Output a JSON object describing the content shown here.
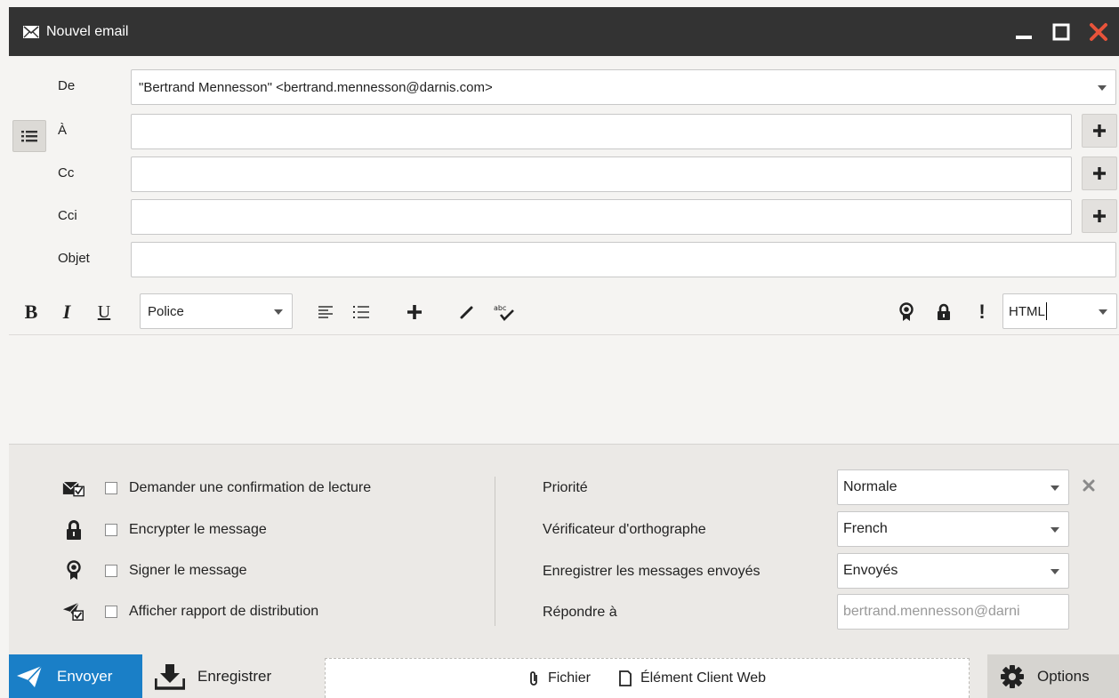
{
  "window": {
    "title": "Nouvel email",
    "icons": {
      "title": "envelope-icon",
      "minimize": "minimize-icon",
      "maximize": "maximize-icon",
      "close": "close-icon"
    },
    "colors": {
      "titlebar_bg": "#333333",
      "close_accent": "#e8533a",
      "send_bg": "#1a7fc7"
    }
  },
  "header": {
    "from": {
      "label": "De",
      "value": "\"Bertrand Mennesson\" <bertrand.mennesson@darnis.com>"
    },
    "to": {
      "label": "À",
      "value": ""
    },
    "cc": {
      "label": "Cc",
      "value": ""
    },
    "bcc": {
      "label": "Cci",
      "value": ""
    },
    "subject": {
      "label": "Objet",
      "value": ""
    }
  },
  "toolbar": {
    "bold": "B",
    "italic": "I",
    "underline": "U",
    "font": "Police",
    "format": "HTML",
    "important": "!"
  },
  "options": {
    "read_receipt": "Demander une confirmation de lecture",
    "encrypt": "Encrypter le message",
    "sign": "Signer le message",
    "delivery_report": "Afficher rapport de distribution",
    "priority": {
      "label": "Priorité",
      "value": "Normale"
    },
    "spellcheck": {
      "label": "Vérificateur d'orthographe",
      "value": "French"
    },
    "save_sent": {
      "label": "Enregistrer les messages envoyés",
      "value": "Envoyés"
    },
    "reply_to": {
      "label": "Répondre à",
      "value": "bertrand.mennesson@darni"
    }
  },
  "bottombar": {
    "send": "Envoyer",
    "save": "Enregistrer",
    "attach_file": "Fichier",
    "attach_item": "Élément Client Web",
    "options": "Options"
  }
}
